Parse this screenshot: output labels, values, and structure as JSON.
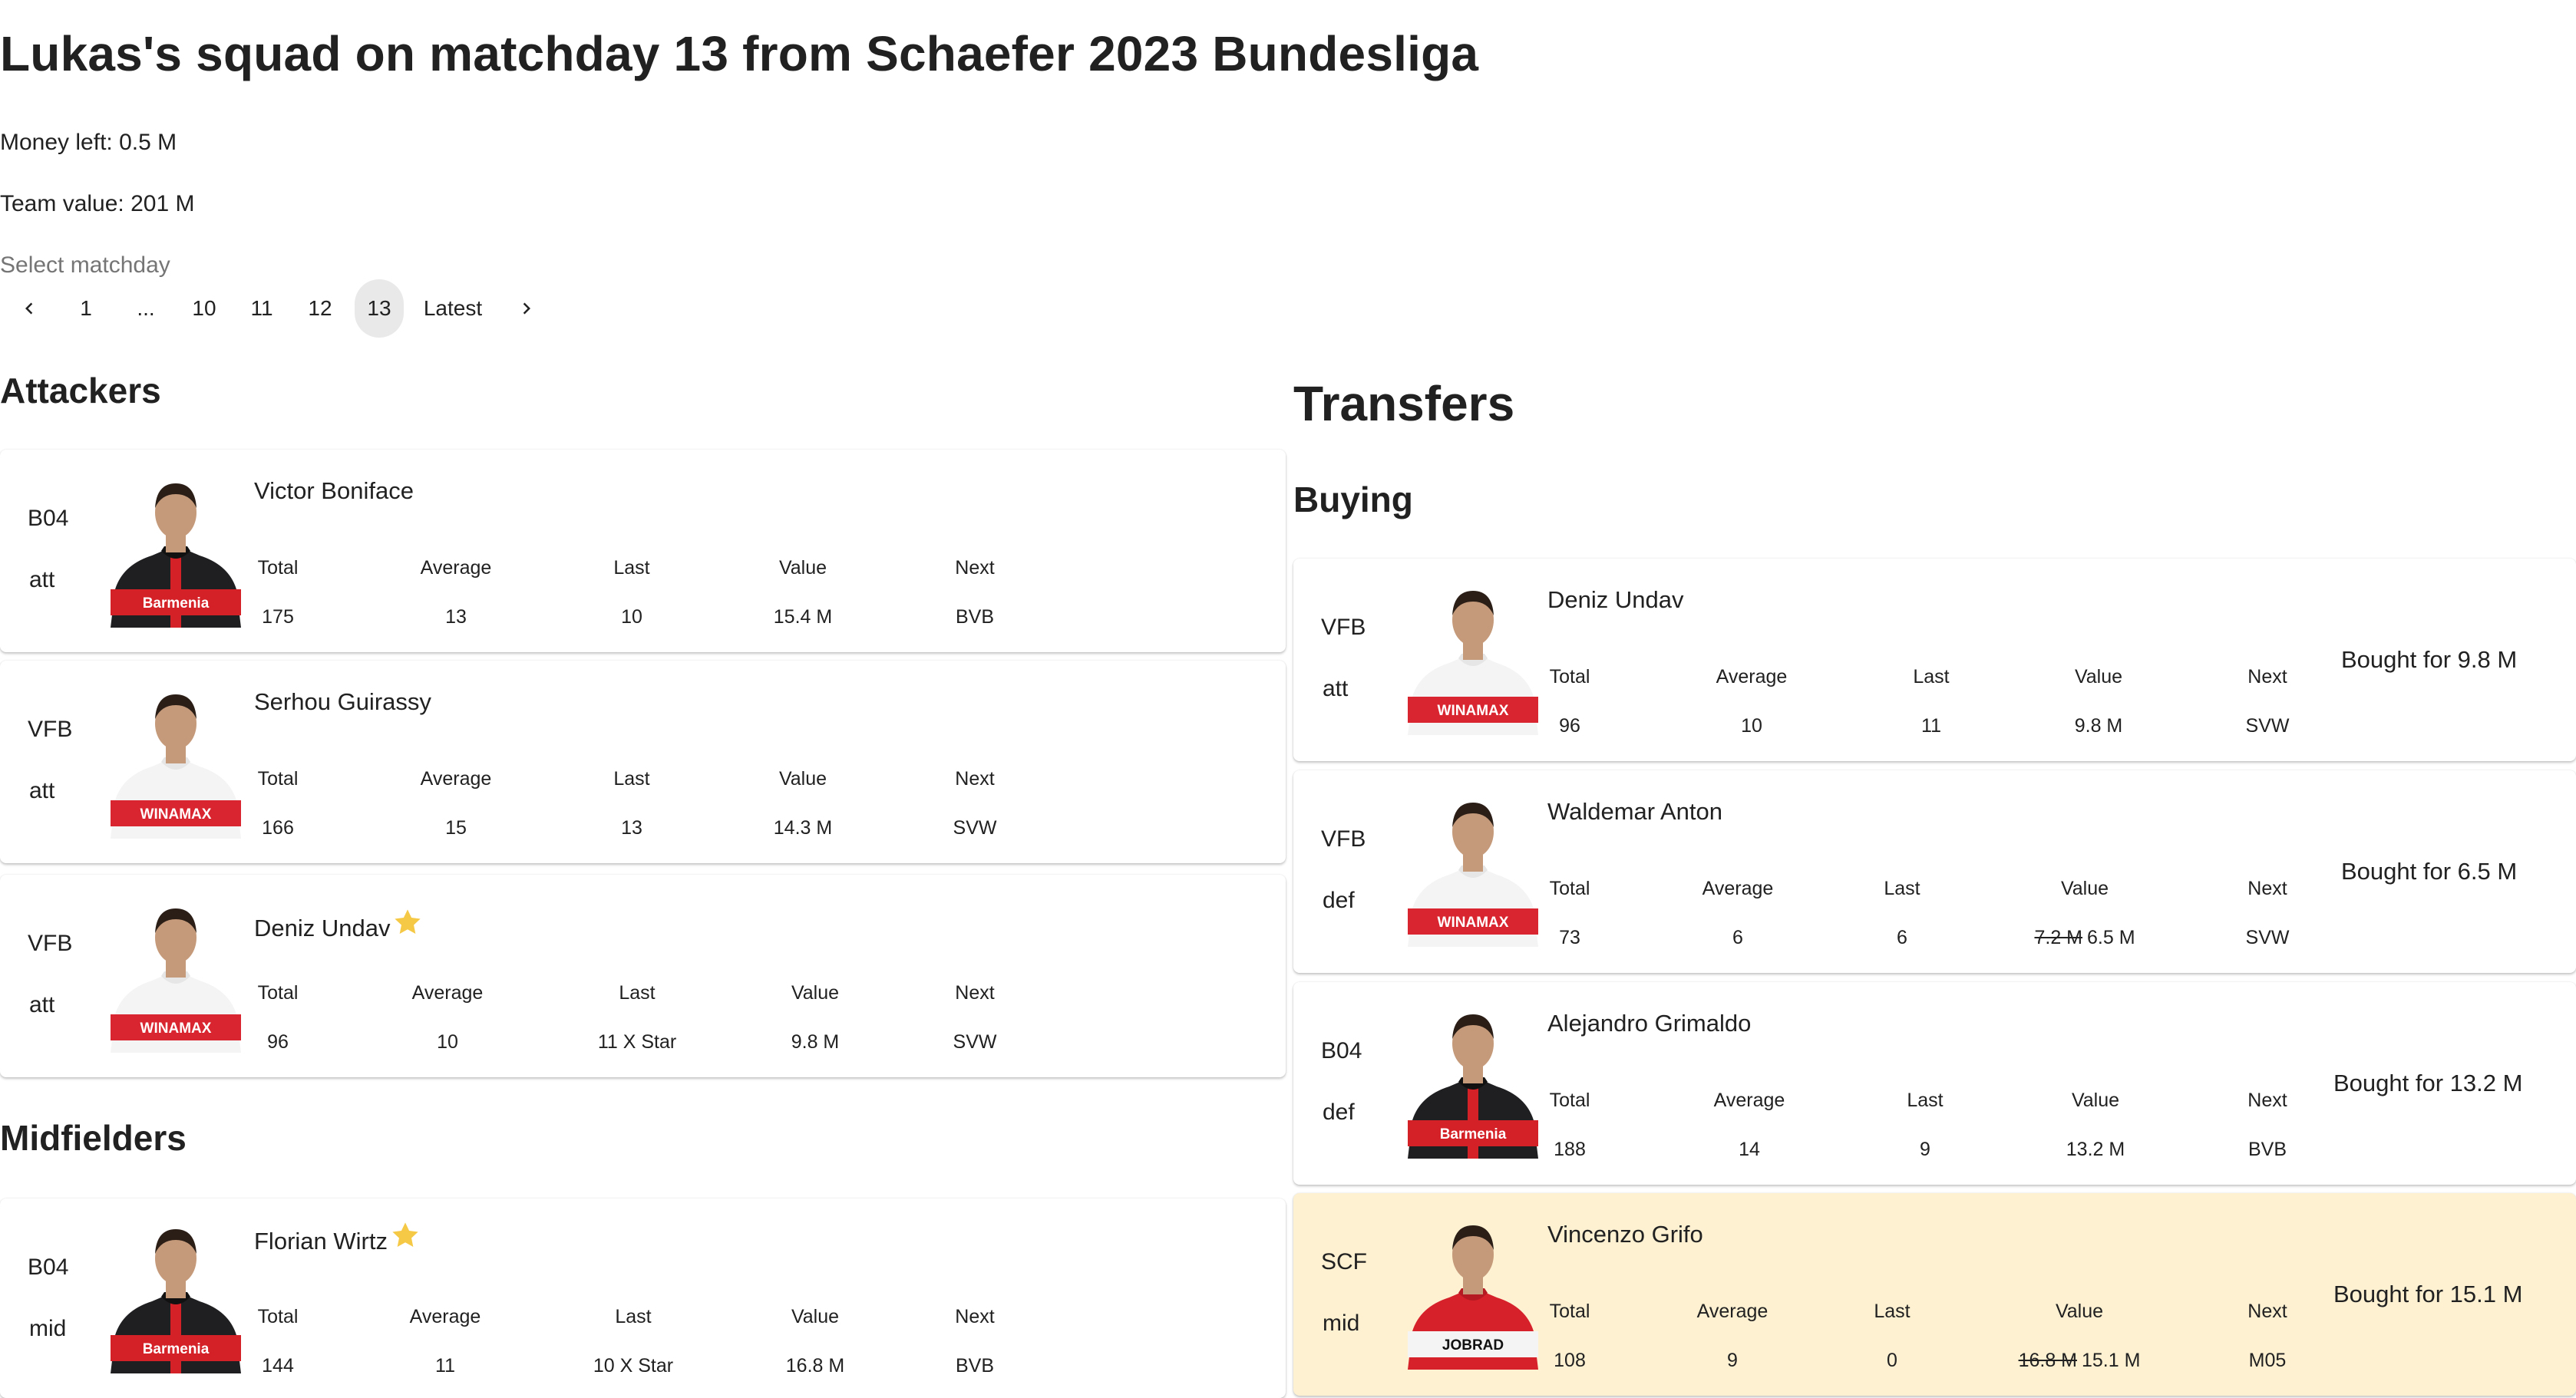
{
  "page": {
    "title": "Lukas's squad on matchday 13 from Schaefer 2023 Bundesliga",
    "money_left": "Money left: 0.5 M",
    "team_value": "Team value: 201 M",
    "select_matchday_label": "Select matchday"
  },
  "pagination": {
    "items": [
      "1",
      "...",
      "10",
      "11",
      "12",
      "13",
      "Latest"
    ],
    "selected": "13",
    "prev_icon": "chevron-left-icon",
    "next_icon": "chevron-right-icon"
  },
  "stat_headers": {
    "total": "Total",
    "average": "Average",
    "last": "Last",
    "value": "Value",
    "next": "Next"
  },
  "sections": {
    "attackers": "Attackers",
    "midfielders": "Midfielders",
    "transfers": "Transfers",
    "buying": "Buying"
  },
  "attackers": [
    {
      "team": "B04",
      "position": "att",
      "name": "Victor Boniface",
      "star": false,
      "kit": "B04",
      "total": "175",
      "average": "13",
      "last": "10",
      "value": "15.4 M",
      "next": "BVB"
    },
    {
      "team": "VFB",
      "position": "att",
      "name": "Serhou Guirassy",
      "star": false,
      "kit": "VFB",
      "total": "166",
      "average": "15",
      "last": "13",
      "value": "14.3 M",
      "next": "SVW"
    },
    {
      "team": "VFB",
      "position": "att",
      "name": "Deniz Undav",
      "star": true,
      "kit": "VFB",
      "total": "96",
      "average": "10",
      "last": "11 X Star",
      "value": "9.8 M",
      "next": "SVW"
    }
  ],
  "midfielders": [
    {
      "team": "B04",
      "position": "mid",
      "name": "Florian Wirtz",
      "star": true,
      "kit": "B04",
      "total": "144",
      "average": "11",
      "last": "10 X Star",
      "value": "16.8 M",
      "next": "BVB"
    }
  ],
  "buying": [
    {
      "team": "VFB",
      "position": "att",
      "name": "Deniz Undav",
      "kit": "VFB",
      "total": "96",
      "average": "10",
      "last": "11",
      "old_value": "",
      "value": "9.8 M",
      "next": "SVW",
      "bought": "Bought for 9.8 M",
      "highlight": false
    },
    {
      "team": "VFB",
      "position": "def",
      "name": "Waldemar Anton",
      "kit": "VFB",
      "total": "73",
      "average": "6",
      "last": "6",
      "old_value": "7.2 M",
      "value": "6.5 M",
      "next": "SVW",
      "bought": "Bought for 6.5 M",
      "highlight": false
    },
    {
      "team": "B04",
      "position": "def",
      "name": "Alejandro Grimaldo",
      "kit": "B04",
      "total": "188",
      "average": "14",
      "last": "9",
      "old_value": "",
      "value": "13.2 M",
      "next": "BVB",
      "bought": "Bought for 13.2 M",
      "highlight": false
    },
    {
      "team": "SCF",
      "position": "mid",
      "name": "Vincenzo Grifo",
      "kit": "SCF",
      "total": "108",
      "average": "9",
      "last": "0",
      "old_value": "16.8 M",
      "value": "15.1 M",
      "next": "M05",
      "bought": "Bought for 15.1 M",
      "highlight": true
    }
  ],
  "kit_logos": {
    "B04": "Barmenia",
    "VFB": "WINAMAX",
    "SCF": "JOBRAD"
  },
  "colors": {
    "highlight_bg": "#fdf1d2",
    "star": "#f5c945",
    "b04_red": "#d42027",
    "vfb_red": "#d9252f",
    "scf_red": "#d6212b"
  }
}
